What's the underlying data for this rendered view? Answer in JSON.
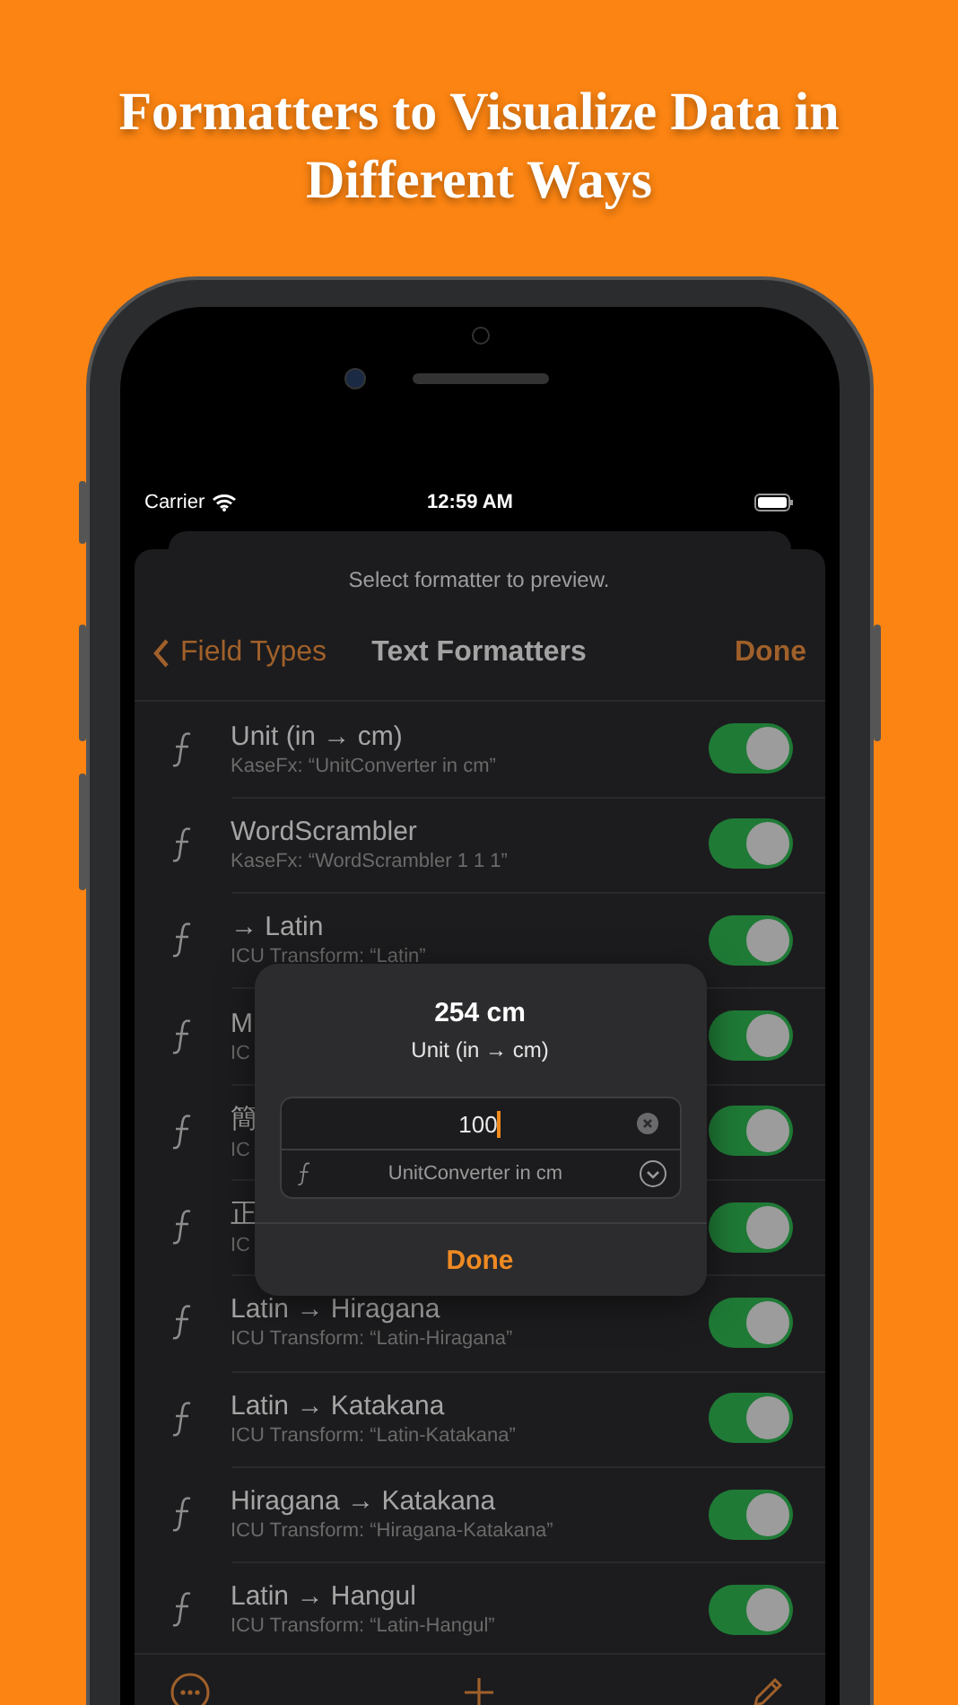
{
  "headline": "Formatters to Visualize Data in Different Ways",
  "status_bar": {
    "carrier": "Carrier",
    "time": "12:59 AM"
  },
  "sheet": {
    "hint": "Select formatter to preview.",
    "nav": {
      "back": "Field Types",
      "title": "Text Formatters",
      "done": "Done"
    },
    "rows": [
      {
        "title": "Unit (in → cm)",
        "subtitle": "KaseFx: “UnitConverter in cm”",
        "on": true
      },
      {
        "title": "WordScrambler",
        "subtitle": "KaseFx: “WordScrambler 1 1 1”",
        "on": true
      },
      {
        "title": "→ Latin",
        "subtitle": "ICU Transform: “Latin”",
        "on": true
      },
      {
        "title": "M",
        "subtitle": "IC",
        "on": true
      },
      {
        "title": "簡",
        "subtitle": "IC",
        "on": true
      },
      {
        "title": "正",
        "subtitle": "IC",
        "on": true
      },
      {
        "title": "Latin → Hiragana",
        "subtitle": "ICU Transform: “Latin-Hiragana”",
        "on": true
      },
      {
        "title": "Latin → Katakana",
        "subtitle": "ICU Transform: “Latin-Katakana”",
        "on": true
      },
      {
        "title": "Hiragana → Katakana",
        "subtitle": "ICU Transform: “Hiragana-Katakana”",
        "on": true
      },
      {
        "title": "Latin → Hangul",
        "subtitle": "ICU Transform: “Latin-Hangul”",
        "on": true
      }
    ]
  },
  "dialog": {
    "result": "254 cm",
    "name": "Unit (in → cm)",
    "value": "100",
    "formatter": "UnitConverter in cm",
    "button": "Done"
  }
}
